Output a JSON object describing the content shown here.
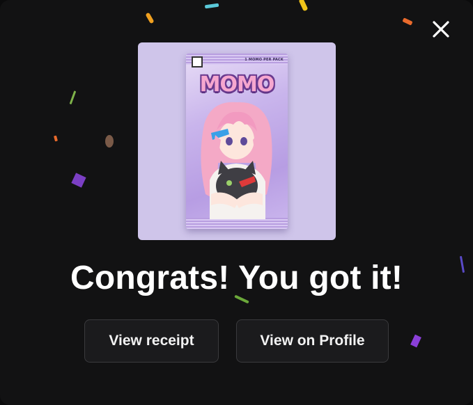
{
  "dialog": {
    "title": "Congrats! You got it!",
    "close_icon": "close-icon",
    "buttons": {
      "receipt_label": "View receipt",
      "profile_label": "View on Profile"
    }
  },
  "pack": {
    "logo_text": "MOMO",
    "per_pack_count": "1",
    "per_pack_label": "MOMO PER PACK"
  },
  "colors": {
    "background": "#121213",
    "card_background": "#cfc5ea",
    "button_background": "#1b1b1d",
    "text": "#ffffff"
  }
}
